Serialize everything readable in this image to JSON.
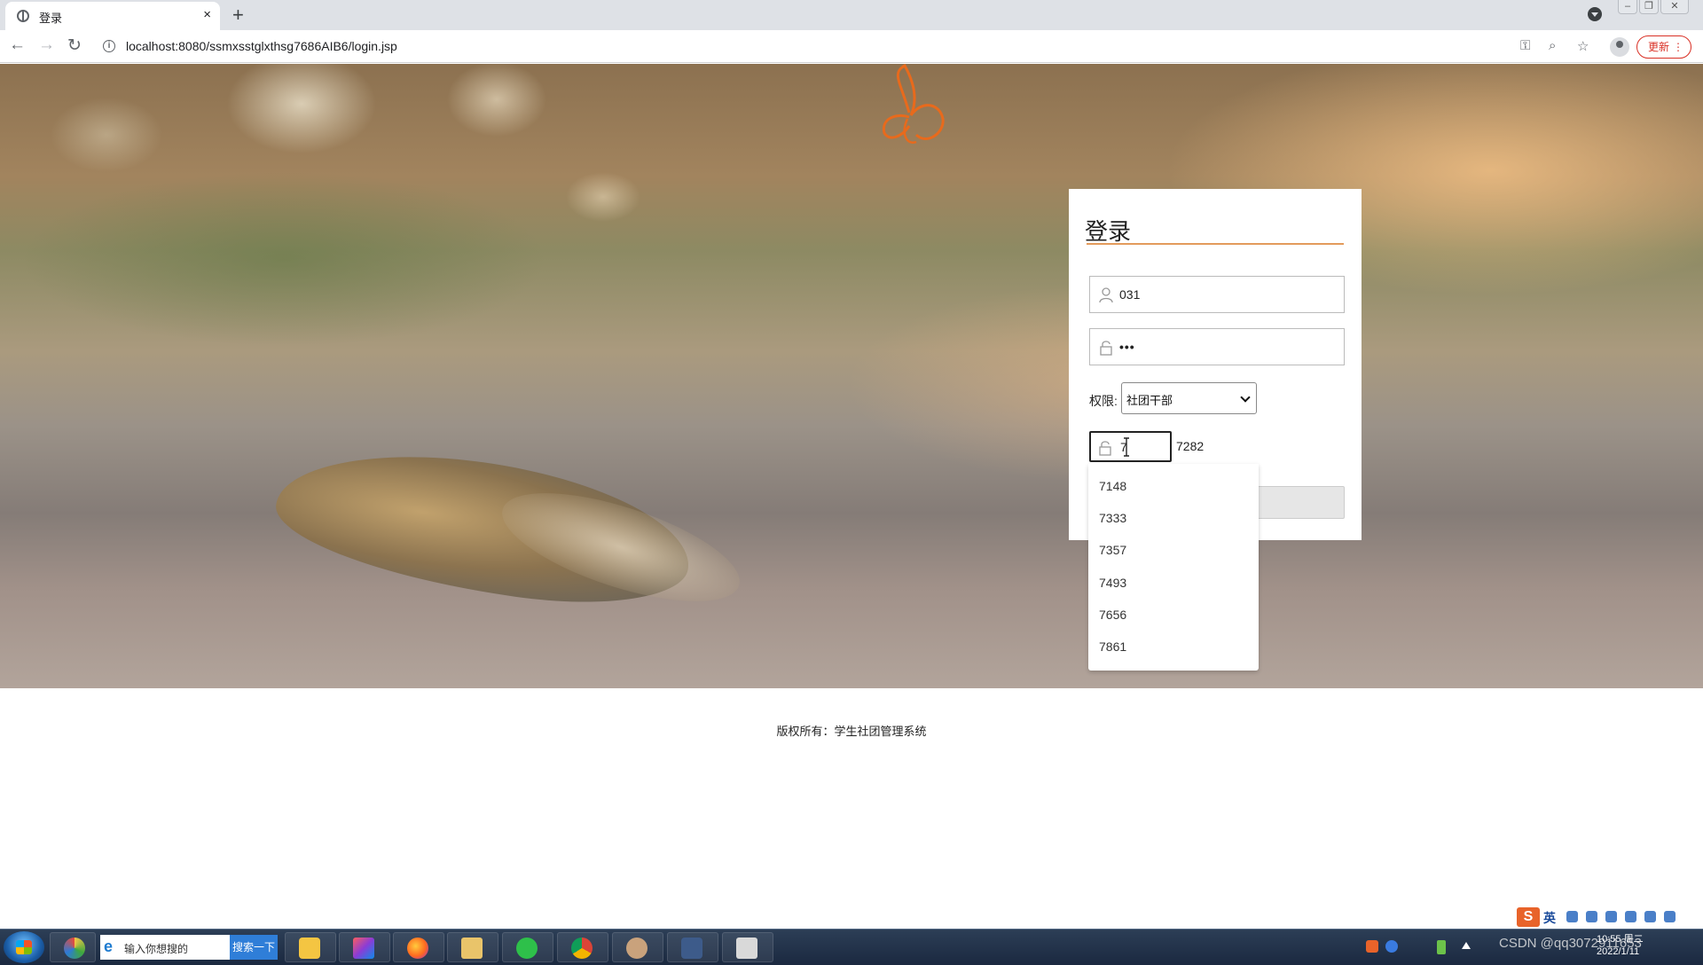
{
  "browser": {
    "tab_title": "登录",
    "tab_close": "×",
    "new_tab": "+",
    "url": "localhost:8080/ssmxsstglxthsg7686AIB6/login.jsp",
    "update_label": "更新",
    "update_menu": "⋮"
  },
  "login": {
    "title": "登录",
    "username_value": "031",
    "password_value": "•••",
    "permission_label": "权限:",
    "permission_selected": "社团干部",
    "captcha_value": "7",
    "captcha_code": "7282"
  },
  "autocomplete": {
    "items": [
      "7148",
      "7333",
      "7357",
      "7493",
      "7656",
      "7861"
    ]
  },
  "footer": {
    "copyright": "版权所有：学生社团管理系统"
  },
  "ime": {
    "lang": "英"
  },
  "taskbar": {
    "search_placeholder": "输入你想搜的",
    "search_button": "搜索一下",
    "clock_time": "10:55 周二",
    "clock_date": "2022/1/11"
  },
  "watermark": "CSDN @qq3072911653",
  "colors": {
    "accent_orange": "#e39b5c",
    "update_red": "#d93025"
  }
}
